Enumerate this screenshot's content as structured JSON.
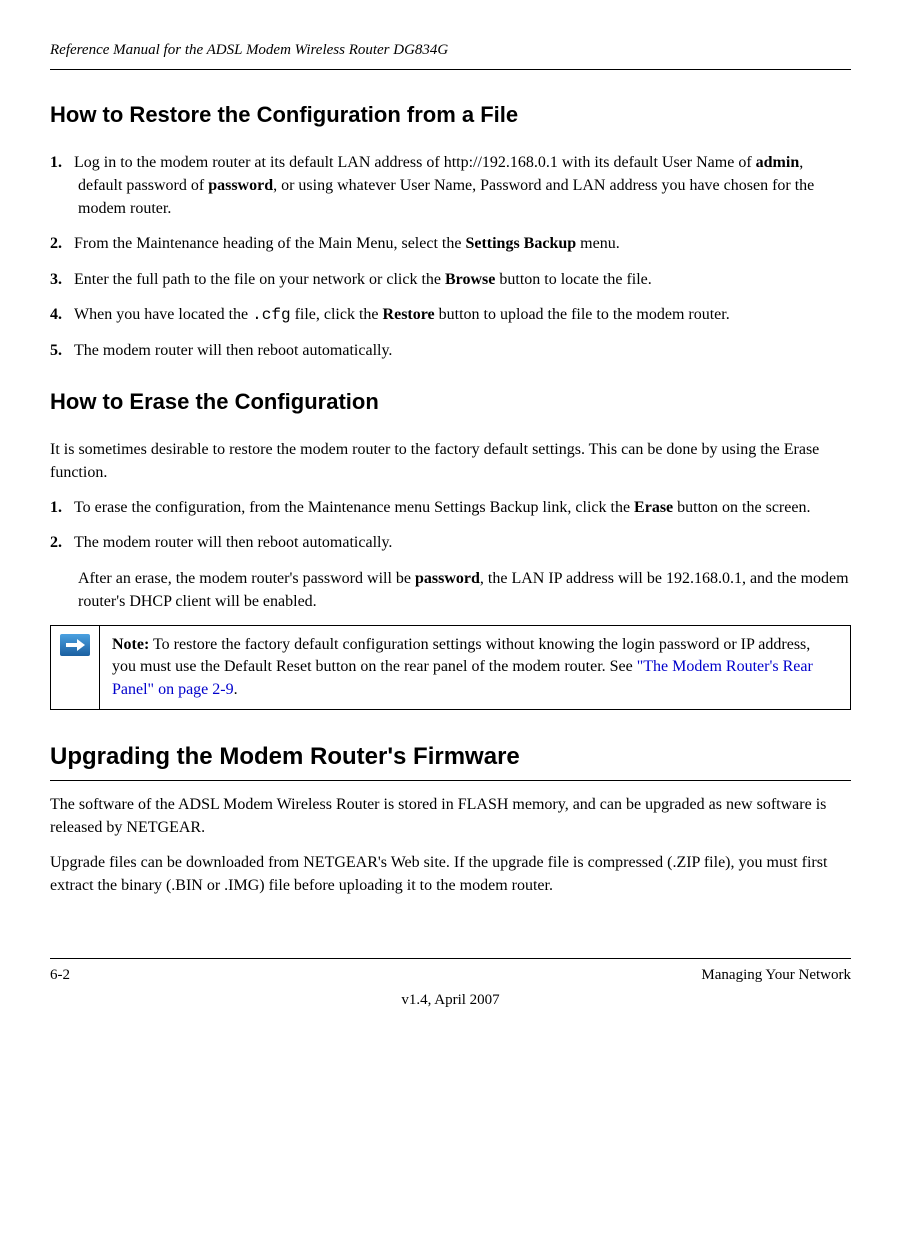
{
  "header": {
    "title": "Reference Manual for the ADSL Modem Wireless Router DG834G"
  },
  "section1": {
    "heading": "How to Restore the Configuration from a File",
    "steps": {
      "s1": {
        "num": "1.",
        "text_a": "Log in to the modem router at its default LAN address of http://192.168.0.1 with its default User Name of ",
        "bold_a": "admin",
        "text_b": ", default password of ",
        "bold_b": "password",
        "text_c": ", or using whatever User Name, Password and LAN address you have chosen for the modem router."
      },
      "s2": {
        "num": "2.",
        "text_a": "From the Maintenance heading of the Main Menu, select the ",
        "bold_a": "Settings Backup",
        "text_b": " menu."
      },
      "s3": {
        "num": "3.",
        "text_a": "Enter the full path to the file on your network or click the ",
        "bold_a": "Browse",
        "text_b": " button to locate the file."
      },
      "s4": {
        "num": "4.",
        "text_a": "When you have located the ",
        "code_a": ".cfg",
        "text_b": " file, click the ",
        "bold_a": "Restore",
        "text_c": " button to upload the file to the modem router."
      },
      "s5": {
        "num": "5.",
        "text_a": "The modem router will then reboot automatically."
      }
    }
  },
  "section2": {
    "heading": "How to Erase the Configuration",
    "intro": "It is sometimes desirable to restore the modem router to the factory default settings. This can be done by using the Erase function.",
    "steps": {
      "s1": {
        "num": "1.",
        "text_a": "To erase the configuration, from the Maintenance menu Settings Backup link, click the ",
        "bold_a": "Erase",
        "text_b": " button on the screen."
      },
      "s2": {
        "num": "2.",
        "text_a": "The modem router will then reboot automatically."
      }
    },
    "after_text_a": "After an erase, the modem router's password will be ",
    "after_bold": "password",
    "after_text_b": ", the LAN IP address will be 192.168.0.1, and the modem router's DHCP client will be enabled.",
    "note": {
      "bold": "Note:",
      "text_a": " To restore the factory default configuration settings without knowing the login password or IP address, you must use the Default Reset button on the rear panel of the modem router. See ",
      "link": "\"The Modem Router's Rear Panel\" on page 2-9",
      "text_b": "."
    }
  },
  "section3": {
    "heading": "Upgrading the Modem Router's Firmware",
    "p1": "The software of the ADSL Modem Wireless Router is stored in FLASH memory, and can be upgraded as new software is released by NETGEAR.",
    "p2": "Upgrade files can be downloaded from NETGEAR's Web site. If the upgrade file is compressed (.ZIP file), you must first extract the binary (.BIN or .IMG) file before uploading it to the modem router."
  },
  "footer": {
    "left": "6-2",
    "right": "Managing Your Network",
    "center": "v1.4, April 2007"
  }
}
